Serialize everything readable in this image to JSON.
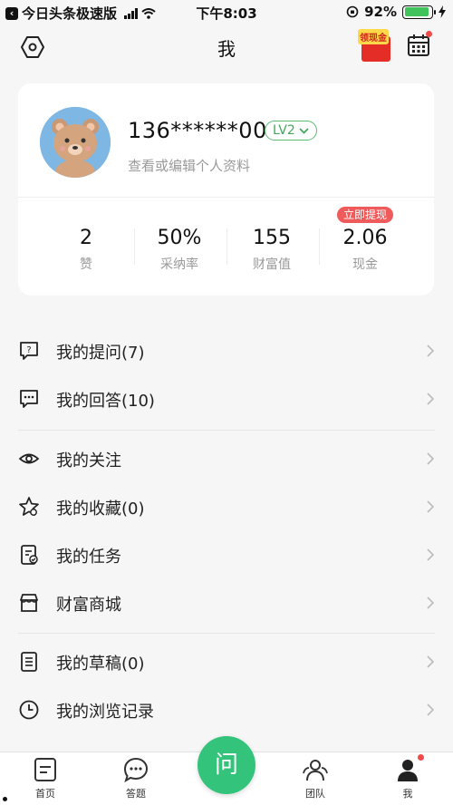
{
  "status_bar": {
    "back_app": "今日头条极速版",
    "time": "下午8:03",
    "battery": "92%",
    "battery_level": 0.92
  },
  "nav": {
    "title": "我",
    "hongbao_label": "领现金",
    "icons": [
      "settings-hexagon-icon",
      "red-envelope-icon",
      "calendar-icon"
    ]
  },
  "profile": {
    "username": "136******00",
    "level": "LV2",
    "edit_hint": "查看或编辑个人资料"
  },
  "stats": [
    {
      "value": "2",
      "label": "赞"
    },
    {
      "value": "50%",
      "label": "采纳率"
    },
    {
      "value": "155",
      "label": "财富值"
    },
    {
      "value": "2.06",
      "label": "现金"
    }
  ],
  "withdraw_badge": "立即提现",
  "menu": [
    {
      "label": "我的提问(7)",
      "icon": "question-bubble-icon"
    },
    {
      "label": "我的回答(10)",
      "icon": "answer-bubble-icon"
    },
    {
      "label": "我的关注",
      "icon": "eye-icon"
    },
    {
      "label": "我的收藏(0)",
      "icon": "star-icon"
    },
    {
      "label": "我的任务",
      "icon": "task-icon"
    },
    {
      "label": "财富商城",
      "icon": "store-icon"
    },
    {
      "label": "我的草稿(0)",
      "icon": "draft-icon"
    },
    {
      "label": "我的浏览记录",
      "icon": "clock-icon"
    }
  ],
  "tabbar": {
    "home": "首页",
    "answer": "答题",
    "ask": "问",
    "team": "团队",
    "me": "我"
  },
  "colors": {
    "accent_green": "#34c37a",
    "level_green": "#44a85a",
    "badge_red": "#ef5a5a"
  }
}
